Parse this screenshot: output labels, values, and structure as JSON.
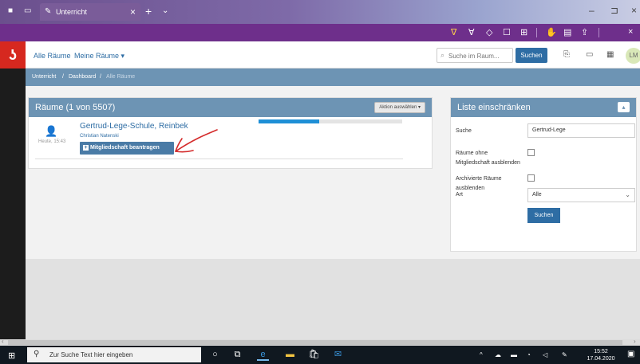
{
  "browser": {
    "tab_title": "Unterricht",
    "new_tab": "+",
    "tab_close": "×",
    "tab_list": "⌄",
    "window_min": "–",
    "window_restore": "⊐",
    "window_close": "×"
  },
  "toolbar": {
    "accent": "#ffd24a",
    "bg": "#6e2f8b"
  },
  "app": {
    "logo_glyph": "ʖ",
    "brand_color": "#d6281f"
  },
  "header": {
    "nav_all_rooms": "Alle Räume",
    "nav_my_rooms": "Meine Räume",
    "nav_my_rooms_caret": "▾",
    "search_placeholder": "Suche im Raum...",
    "search_button": "Suchen",
    "avatar_initials": "LM"
  },
  "breadcrumb": {
    "items": [
      "Unterricht",
      "Dashboard",
      "Alle Räume"
    ],
    "separator": "/"
  },
  "rooms_panel": {
    "title": "Räume (1 von 5507)",
    "action_button": "Aktion auswählen ▾",
    "room": {
      "name": "Gertrud-Lege-Schule, Reinbek",
      "owner": "Christian Natenski",
      "time": "Heute, 15:43",
      "join_button": "Mitgliedschaft beantragen",
      "progress": 0.42
    }
  },
  "filter_panel": {
    "title": "Liste einschränken",
    "collapse_icon": "▴",
    "search_label": "Suche",
    "search_value": "Gertrud-Lege",
    "no_membership_label_1": "Räume ohne",
    "no_membership_label_2": "Mitgliedschaft ausblenden",
    "archived_label_1": "Archivierte Räume",
    "archived_label_2": "ausblenden",
    "type_label": "Art",
    "type_value": "Alle",
    "submit_button": "Suchen"
  },
  "taskbar": {
    "search_text": "Zur Suche Text hier eingeben",
    "time": "15:52",
    "date": "17.04.2020"
  }
}
